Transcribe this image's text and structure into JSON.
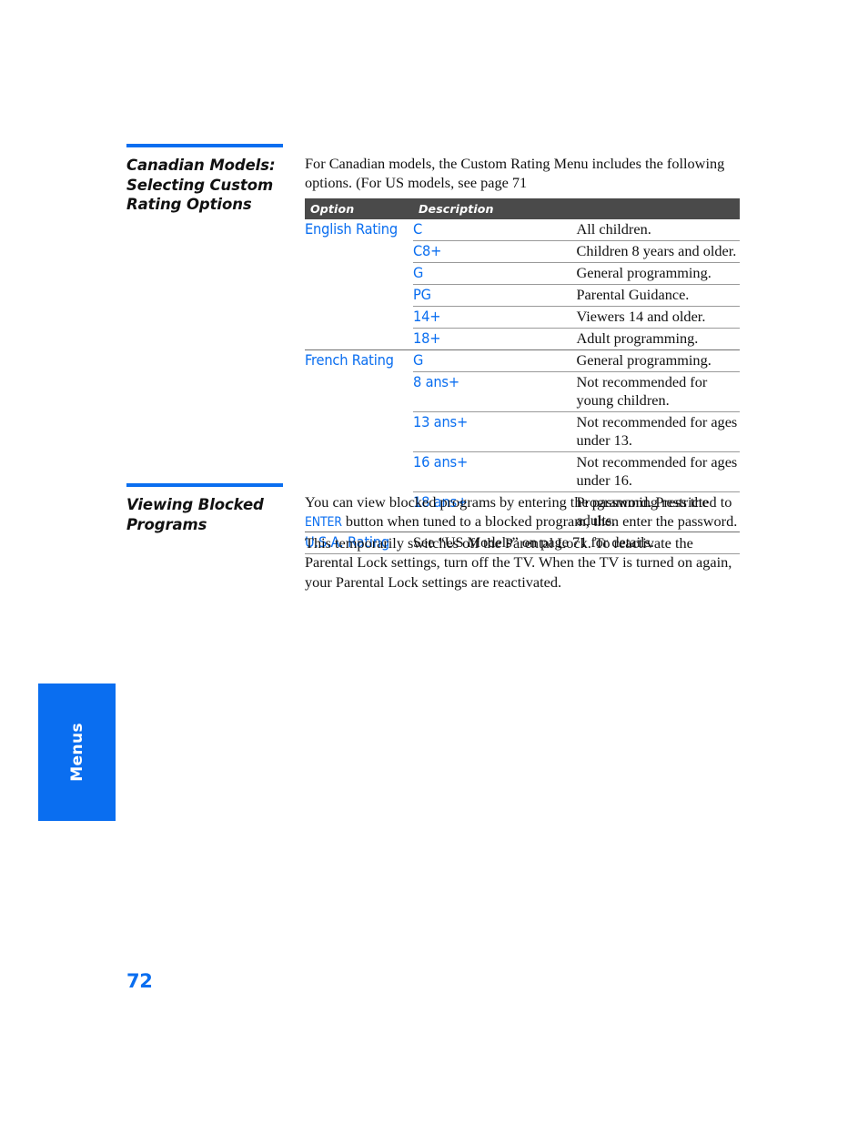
{
  "page": {
    "number": "72",
    "side_tab_label": "Menus"
  },
  "sections": [
    {
      "heading": "Canadian Models: Selecting Custom Rating Options",
      "intro": "For Canadian models, the Custom Rating Menu includes the following options. (For US models, see page 71"
    },
    {
      "heading": "Viewing Blocked Programs",
      "body_part1": "You can view blocked programs by entering the password. Press the ",
      "body_keycap": "ENTER",
      "body_part2": " button when tuned to a blocked program, then enter the password. This temporarily switches off the Parental Lock. To reactivate the Parental Lock settings, turn off the TV. When the TV is turned on again, your Parental Lock settings are reactivated."
    }
  ],
  "table": {
    "headers": {
      "option": "Option",
      "description": "Description"
    },
    "rows": [
      {
        "option": "English Rating",
        "code": "C",
        "desc": "All children.",
        "rule": "none"
      },
      {
        "option": "",
        "code": "C8+",
        "desc": "Children 8 years and older.",
        "rule": "sub"
      },
      {
        "option": "",
        "code": "G",
        "desc": "General programming.",
        "rule": "sub"
      },
      {
        "option": "",
        "code": "PG",
        "desc": "Parental Guidance.",
        "rule": "sub"
      },
      {
        "option": "",
        "code": "14+",
        "desc": "Viewers 14 and older.",
        "rule": "sub"
      },
      {
        "option": "",
        "code": "18+",
        "desc": "Adult programming.",
        "rule": "sub"
      },
      {
        "option": "French Rating",
        "code": "G",
        "desc": "General programming.",
        "rule": "full"
      },
      {
        "option": "",
        "code": "8 ans+",
        "desc": "Not recommended for young children.",
        "rule": "sub"
      },
      {
        "option": "",
        "code": "13 ans+",
        "desc": "Not recommended for ages under 13.",
        "rule": "sub"
      },
      {
        "option": "",
        "code": "16 ans+",
        "desc": "Not recommended for ages under 16.",
        "rule": "sub"
      },
      {
        "option": "",
        "code": "18 ans+",
        "desc": "Programming restricted to adults.",
        "rule": "sub"
      },
      {
        "option": "U.S.A. Rating",
        "code": "See “US Models” on page 71 for details.",
        "desc": "",
        "rule": "full",
        "span": true
      }
    ]
  },
  "colors": {
    "accent_blue": "#0a6ef0",
    "header_bar": "#4a4a4a",
    "rule_gray": "#9a9a9a",
    "text": "#111111"
  }
}
